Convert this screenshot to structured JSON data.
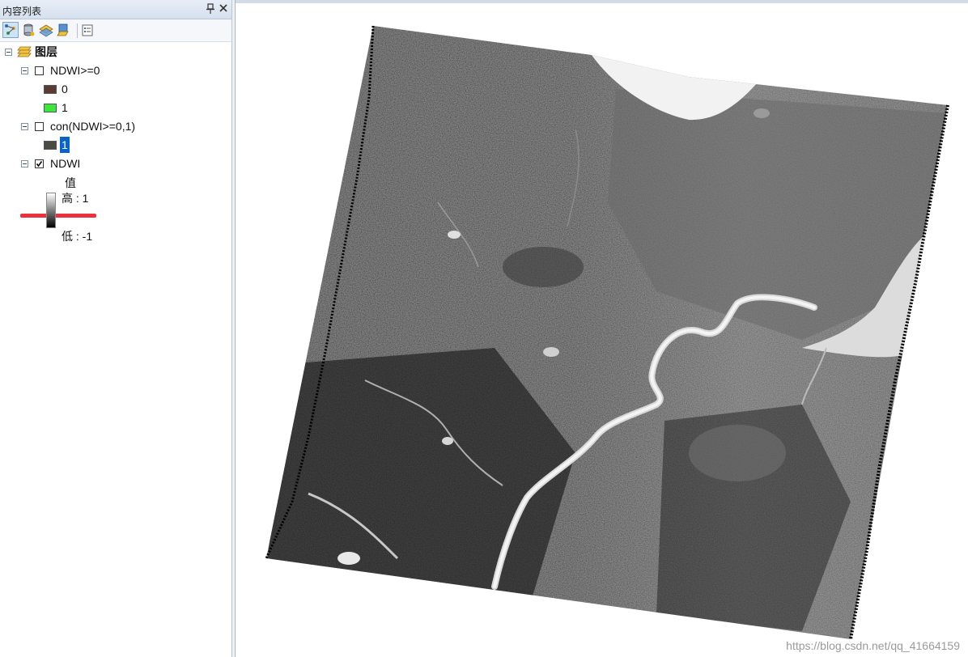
{
  "toc": {
    "title": "内容列表",
    "pin_glyph": "ᵖ",
    "close_glyph": "✕",
    "tools": [
      {
        "icon": "list-by-drawing-order-icon",
        "active": true
      },
      {
        "icon": "list-by-source-icon",
        "active": false
      },
      {
        "icon": "list-by-visibility-icon",
        "active": false
      },
      {
        "icon": "list-by-selection-icon",
        "active": false
      },
      {
        "icon": "options-icon",
        "active": false
      }
    ],
    "root_label": "图层",
    "layers": [
      {
        "label": "NDWI>=0",
        "checked": false,
        "classes": [
          {
            "label": "0",
            "color": "#5a3c34"
          },
          {
            "label": "1",
            "color": "#3ce63c"
          }
        ]
      },
      {
        "label": "con(NDWI>=0,1)",
        "checked": false,
        "classes": [
          {
            "label": "1",
            "color": "#4b4b42",
            "selected": true
          }
        ]
      },
      {
        "label": "NDWI",
        "checked": true,
        "legend": {
          "heading": "值",
          "high": "高 : 1",
          "low": "低 : -1"
        }
      }
    ],
    "highlight_color": "#e8323c",
    "selection_color": "#0a64c8"
  },
  "map": {
    "watermark": "https://blog.csdn.net/qq_41664159"
  }
}
